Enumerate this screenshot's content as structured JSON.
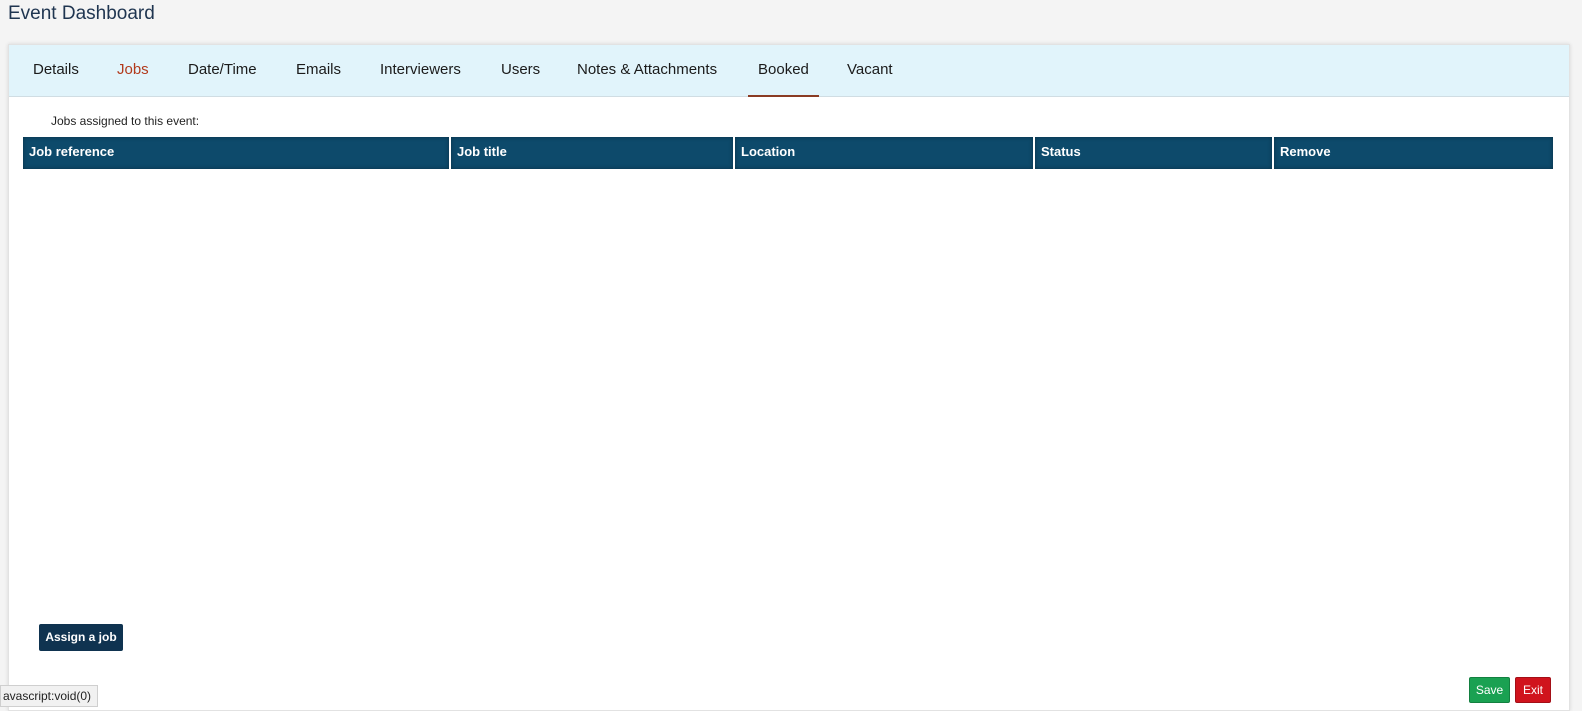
{
  "page": {
    "title": "Event Dashboard"
  },
  "tabs": [
    {
      "label": "Details"
    },
    {
      "label": "Jobs"
    },
    {
      "label": "Date/Time"
    },
    {
      "label": "Emails"
    },
    {
      "label": "Interviewers"
    },
    {
      "label": "Users"
    },
    {
      "label": "Notes & Attachments"
    },
    {
      "label": "Booked"
    },
    {
      "label": "Vacant"
    }
  ],
  "jobs": {
    "caption": "Jobs assigned to this event:",
    "columns": [
      "Job reference",
      "Job title",
      "Location",
      "Status",
      "Remove"
    ],
    "rows": []
  },
  "buttons": {
    "assign": "Assign a job",
    "save": "Save",
    "exit": "Exit"
  },
  "status_bar": {
    "text": "avascript:void(0)"
  },
  "colors": {
    "header_bg": "#0d4a6b",
    "tabbar_bg": "#e1f4fb",
    "active_tab": "#b23a1c",
    "save": "#1aa152",
    "exit": "#d0131d"
  }
}
